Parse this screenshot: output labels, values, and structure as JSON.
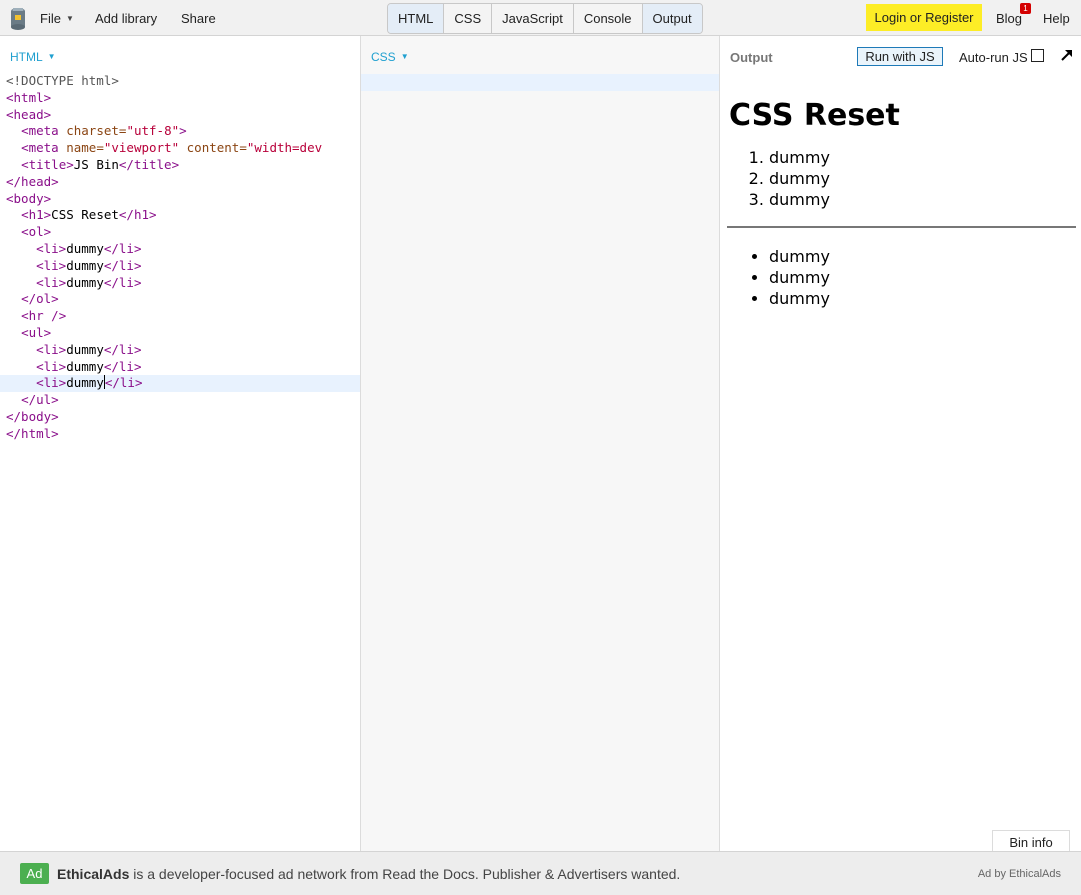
{
  "topbar": {
    "menu": [
      {
        "label": "File"
      },
      {
        "label": "Add library"
      },
      {
        "label": "Share"
      }
    ],
    "panel_tabs": [
      {
        "label": "HTML",
        "active": true
      },
      {
        "label": "CSS",
        "active": false
      },
      {
        "label": "JavaScript",
        "active": false
      },
      {
        "label": "Console",
        "active": false
      },
      {
        "label": "Output",
        "active": true
      }
    ],
    "login_label": "Login or Register",
    "blog_label": "Blog",
    "blog_badge": "1",
    "help_label": "Help"
  },
  "html_panel": {
    "label": "HTML",
    "code": [
      [
        [
          "d",
          "<!DOCTYPE html>"
        ]
      ],
      [
        [
          "t",
          "<html>"
        ]
      ],
      [
        [
          "t",
          "<head>"
        ]
      ],
      [
        [
          "x",
          "  "
        ],
        [
          "t",
          "<meta "
        ],
        [
          "a",
          "charset="
        ],
        [
          "s",
          "\"utf-8\""
        ],
        [
          "t",
          ">"
        ]
      ],
      [
        [
          "x",
          "  "
        ],
        [
          "t",
          "<meta "
        ],
        [
          "a",
          "name="
        ],
        [
          "s",
          "\"viewport\""
        ],
        [
          "x",
          " "
        ],
        [
          "a",
          "content="
        ],
        [
          "s",
          "\"width=dev"
        ]
      ],
      [
        [
          "x",
          "  "
        ],
        [
          "t",
          "<title>"
        ],
        [
          "x",
          "JS Bin"
        ],
        [
          "t",
          "</title>"
        ]
      ],
      [
        [
          "t",
          "</head>"
        ]
      ],
      [
        [
          "t",
          "<body>"
        ]
      ],
      [
        [
          "x",
          "  "
        ],
        [
          "t",
          "<h1>"
        ],
        [
          "x",
          "CSS Reset"
        ],
        [
          "t",
          "</h1>"
        ]
      ],
      [
        [
          "x",
          "  "
        ],
        [
          "t",
          "<ol>"
        ]
      ],
      [
        [
          "x",
          "    "
        ],
        [
          "t",
          "<li>"
        ],
        [
          "x",
          "dummy"
        ],
        [
          "t",
          "</li>"
        ]
      ],
      [
        [
          "x",
          "    "
        ],
        [
          "t",
          "<li>"
        ],
        [
          "x",
          "dummy"
        ],
        [
          "t",
          "</li>"
        ]
      ],
      [
        [
          "x",
          "    "
        ],
        [
          "t",
          "<li>"
        ],
        [
          "x",
          "dummy"
        ],
        [
          "t",
          "</li>"
        ]
      ],
      [
        [
          "x",
          "  "
        ],
        [
          "t",
          "</ol>"
        ]
      ],
      [
        [
          "x",
          "  "
        ],
        [
          "t",
          "<hr />"
        ]
      ],
      [
        [
          "x",
          "  "
        ],
        [
          "t",
          "<ul>"
        ]
      ],
      [
        [
          "x",
          "    "
        ],
        [
          "t",
          "<li>"
        ],
        [
          "x",
          "dummy"
        ],
        [
          "t",
          "</li>"
        ]
      ],
      [
        [
          "x",
          "    "
        ],
        [
          "t",
          "<li>"
        ],
        [
          "x",
          "dummy"
        ],
        [
          "t",
          "</li>"
        ]
      ],
      [
        [
          "x",
          "    "
        ],
        [
          "t",
          "<li>"
        ],
        [
          "x",
          "dummy"
        ],
        [
          "c",
          ""
        ],
        [
          "t",
          "</li>"
        ]
      ],
      [
        [
          "x",
          "  "
        ],
        [
          "t",
          "</ul>"
        ]
      ],
      [
        [
          "t",
          "</body>"
        ]
      ],
      [
        [
          "t",
          "</html>"
        ]
      ]
    ],
    "current_line": 18
  },
  "css_panel": {
    "label": "CSS"
  },
  "output_panel": {
    "title": "Output",
    "run_js_label": "Run with JS",
    "autorun_label": "Auto-run JS",
    "autorun_checked": false,
    "bin_info_label": "Bin info",
    "preview": {
      "heading": "CSS Reset",
      "ordered_items": [
        "dummy",
        "dummy",
        "dummy"
      ],
      "unordered_items": [
        "dummy",
        "dummy",
        "dummy"
      ]
    }
  },
  "ad": {
    "badge": "Ad",
    "brand": "EthicalAds",
    "text": " is a developer-focused ad network from Read the Docs. Publisher & Advertisers wanted.",
    "by": "Ad by EthicalAds"
  },
  "colors": {
    "login_button": "#fded26",
    "panel_label": "#20a0d0",
    "ad_badge": "#4caf50",
    "blog_badge": "#d40000",
    "html_tag": "#8a0f8a",
    "html_attr": "#8b4513",
    "html_string": "#b8003a"
  }
}
